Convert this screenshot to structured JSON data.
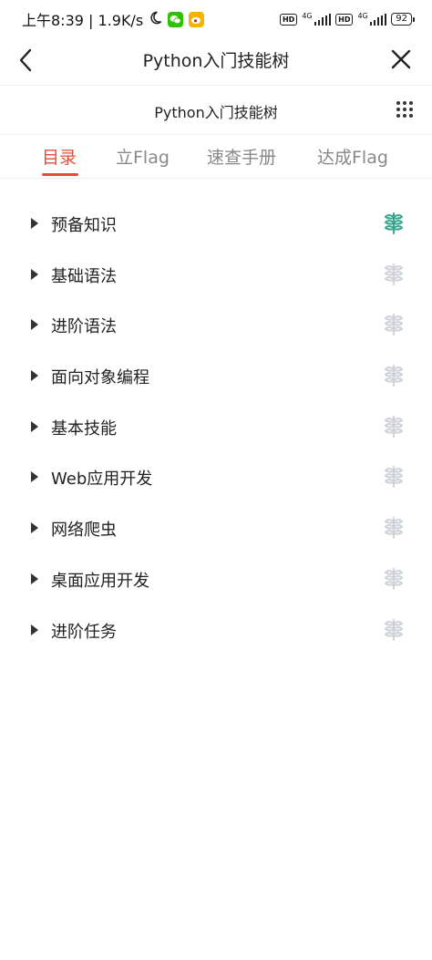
{
  "status_bar": {
    "time_speed": "上午8:39 | 1.9K/s",
    "net1": "4G",
    "net2": "4G",
    "battery": "92"
  },
  "nav": {
    "title": "Python入门技能树"
  },
  "sub_header": {
    "title": "Python入门技能树"
  },
  "tabs": [
    {
      "label": "目录"
    },
    {
      "label": "立Flag"
    },
    {
      "label": "速查手册"
    },
    {
      "label": "达成Flag"
    }
  ],
  "active_tab": "目录",
  "items": [
    {
      "label": "预备知识"
    },
    {
      "label": "基础语法"
    },
    {
      "label": "进阶语法"
    },
    {
      "label": "面向对象编程"
    },
    {
      "label": "基本技能"
    },
    {
      "label": "Web应用开发"
    },
    {
      "label": "网络爬虫"
    },
    {
      "label": "桌面应用开发"
    },
    {
      "label": "进阶任务"
    }
  ],
  "colors": {
    "accent": "#e44d3b",
    "leaf_active": "#3aa58e",
    "leaf_inactive": "#cfd3d8"
  }
}
